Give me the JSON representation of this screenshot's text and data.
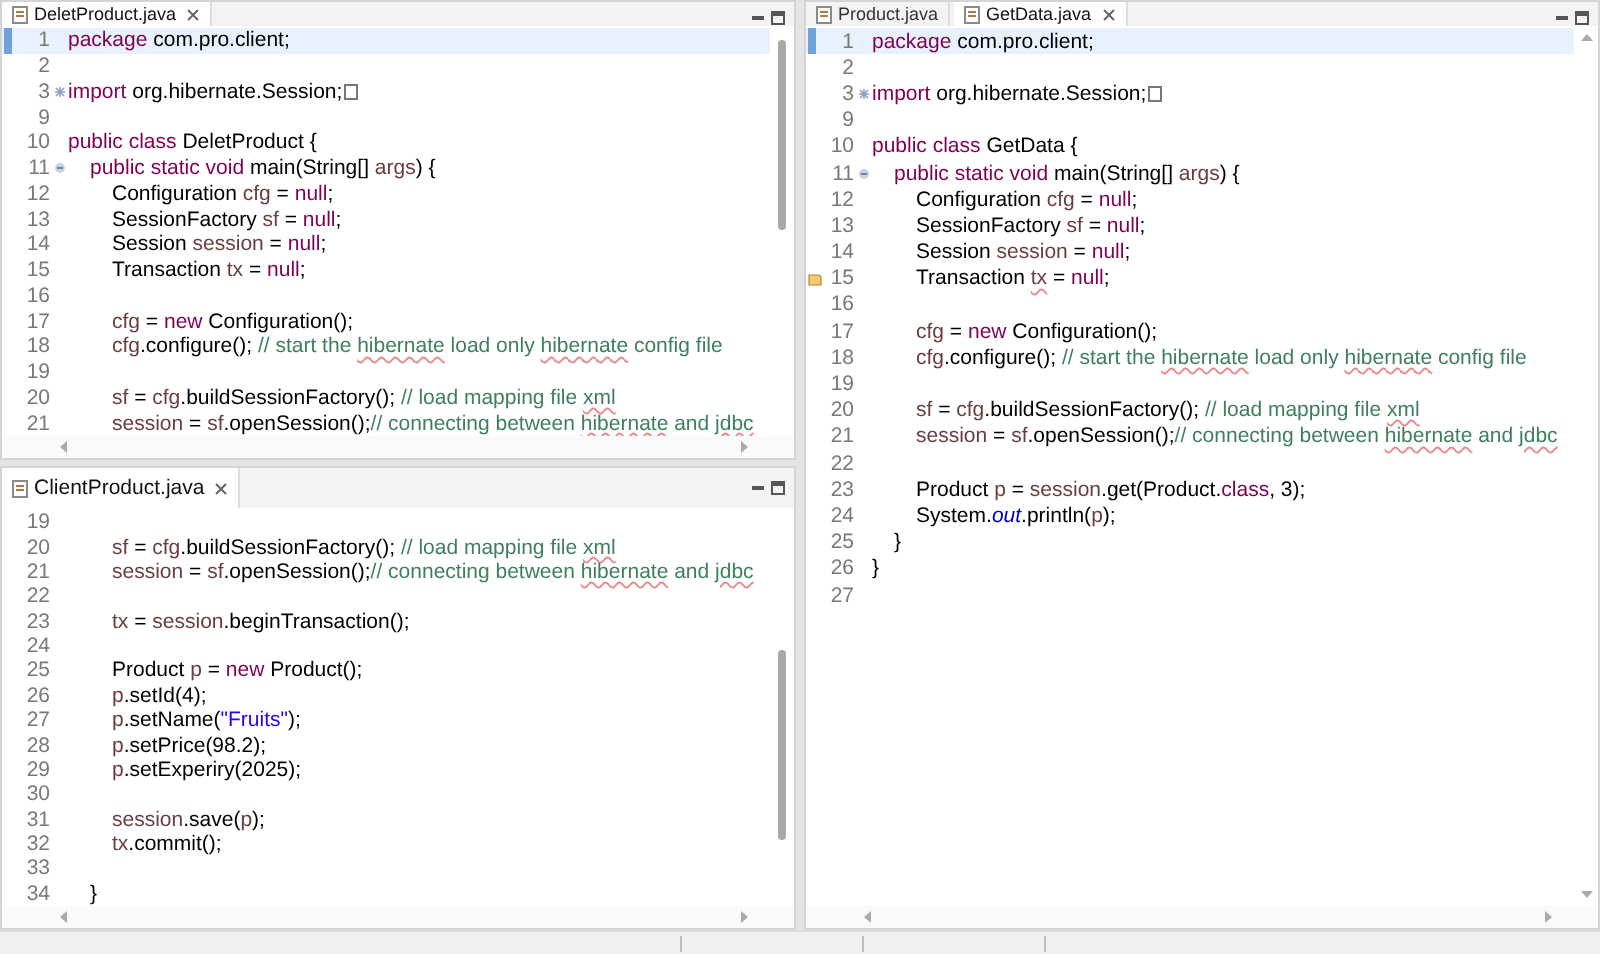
{
  "editors": [
    {
      "tabs": [
        {
          "label": "DeletProduct.java",
          "selected": true
        }
      ],
      "lines": [
        {
          "num": "1",
          "highlighted": true,
          "segs": [
            {
              "kind": "kw",
              "text": "package"
            },
            {
              "kind": "plain",
              "text": " com.pro.client;"
            }
          ]
        },
        {
          "num": "2"
        },
        {
          "num": "3",
          "collapsed": true,
          "segs": [
            {
              "kind": "kw",
              "text": "import"
            },
            {
              "kind": "plain",
              "text": " org.hibernate.Session;"
            }
          ]
        },
        {
          "num": "9"
        },
        {
          "num": "10",
          "segs": [
            {
              "kind": "kw",
              "text": "public class"
            },
            {
              "kind": "plain",
              "text": " DeletProduct {"
            }
          ]
        },
        {
          "num": "11",
          "collapsed": false,
          "segs": [
            {
              "kind": "kw",
              "text": "\tpublic static void"
            },
            {
              "kind": "plain",
              "text": " main(String[] "
            },
            {
              "kind": "var",
              "text": "args"
            },
            {
              "kind": "plain",
              "text": ") {"
            }
          ]
        },
        {
          "num": "12",
          "segs": [
            {
              "kind": "plain",
              "text": "\t\tConfiguration "
            },
            {
              "kind": "var",
              "text": "cfg"
            },
            {
              "kind": "plain",
              "text": " = "
            },
            {
              "kind": "kw",
              "text": "null"
            },
            {
              "kind": "plain",
              "text": ";"
            }
          ]
        },
        {
          "num": "13",
          "segs": [
            {
              "kind": "plain",
              "text": "\t\tSessionFactory "
            },
            {
              "kind": "var",
              "text": "sf"
            },
            {
              "kind": "plain",
              "text": " = "
            },
            {
              "kind": "kw",
              "text": "null"
            },
            {
              "kind": "plain",
              "text": ";"
            }
          ]
        },
        {
          "num": "14",
          "segs": [
            {
              "kind": "plain",
              "text": "\t\tSession "
            },
            {
              "kind": "var",
              "text": "session"
            },
            {
              "kind": "plain",
              "text": " = "
            },
            {
              "kind": "kw",
              "text": "null"
            },
            {
              "kind": "plain",
              "text": ";"
            }
          ]
        },
        {
          "num": "15",
          "segs": [
            {
              "kind": "plain",
              "text": "\t\tTransaction "
            },
            {
              "kind": "var",
              "text": "tx"
            },
            {
              "kind": "plain",
              "text": " = "
            },
            {
              "kind": "kw",
              "text": "null"
            },
            {
              "kind": "plain",
              "text": ";"
            }
          ]
        },
        {
          "num": "16"
        },
        {
          "num": "17",
          "segs": [
            {
              "kind": "var",
              "text": "\t\tcfg"
            },
            {
              "kind": "plain",
              "text": " = "
            },
            {
              "kind": "kw",
              "text": "new"
            },
            {
              "kind": "plain",
              "text": " Configuration();"
            }
          ]
        },
        {
          "num": "18",
          "segs": [
            {
              "kind": "var",
              "text": "\t\tcfg"
            },
            {
              "kind": "plain",
              "text": ".configure(); "
            },
            {
              "kind": "comment",
              "text": "// start the "
            },
            {
              "kind": "comment",
              "text": "hibernate",
              "underlined": true
            },
            {
              "kind": "comment",
              "text": " load only "
            },
            {
              "kind": "comment",
              "text": "hibernate",
              "underlined": true
            },
            {
              "kind": "comment",
              "text": " config file"
            }
          ]
        },
        {
          "num": "19"
        },
        {
          "num": "20",
          "segs": [
            {
              "kind": "var",
              "text": "\t\tsf"
            },
            {
              "kind": "plain",
              "text": " = "
            },
            {
              "kind": "var",
              "text": "cfg"
            },
            {
              "kind": "plain",
              "text": ".buildSessionFactory(); "
            },
            {
              "kind": "comment",
              "text": "// load mapping file "
            },
            {
              "kind": "comment",
              "text": "xml",
              "underlined": true
            }
          ]
        },
        {
          "num": "21",
          "segs": [
            {
              "kind": "var",
              "text": "\t\tsession"
            },
            {
              "kind": "plain",
              "text": " = "
            },
            {
              "kind": "var",
              "text": "sf"
            },
            {
              "kind": "plain",
              "text": ".openSession();"
            },
            {
              "kind": "comment",
              "text": "// connecting between "
            },
            {
              "kind": "comment",
              "text": "hibernate",
              "underlined": true
            },
            {
              "kind": "comment",
              "text": " and "
            },
            {
              "kind": "comment",
              "text": "jdbc",
              "underlined": true
            }
          ]
        }
      ]
    },
    {
      "tabs": [
        {
          "label": "ClientProduct.java",
          "selected": true
        }
      ],
      "lines": [
        {
          "num": "19"
        },
        {
          "num": "20",
          "segs": [
            {
              "kind": "var",
              "text": "\t\tsf"
            },
            {
              "kind": "plain",
              "text": " = "
            },
            {
              "kind": "var",
              "text": "cfg"
            },
            {
              "kind": "plain",
              "text": ".buildSessionFactory(); "
            },
            {
              "kind": "comment",
              "text": "// load mapping file "
            },
            {
              "kind": "comment",
              "text": "xml",
              "underlined": true
            }
          ]
        },
        {
          "num": "21",
          "segs": [
            {
              "kind": "var",
              "text": "\t\tsession"
            },
            {
              "kind": "plain",
              "text": " = "
            },
            {
              "kind": "var",
              "text": "sf"
            },
            {
              "kind": "plain",
              "text": ".openSession();"
            },
            {
              "kind": "comment",
              "text": "// connecting between "
            },
            {
              "kind": "comment",
              "text": "hibernate",
              "underlined": true
            },
            {
              "kind": "comment",
              "text": " and "
            },
            {
              "kind": "comment",
              "text": "jdbc",
              "underlined": true
            }
          ]
        },
        {
          "num": "22"
        },
        {
          "num": "23",
          "segs": [
            {
              "kind": "var",
              "text": "\t\ttx"
            },
            {
              "kind": "plain",
              "text": " = "
            },
            {
              "kind": "var",
              "text": "session"
            },
            {
              "kind": "plain",
              "text": ".beginTransaction();"
            }
          ]
        },
        {
          "num": "24"
        },
        {
          "num": "25",
          "segs": [
            {
              "kind": "plain",
              "text": "\t\tProduct "
            },
            {
              "kind": "var",
              "text": "p"
            },
            {
              "kind": "plain",
              "text": " = "
            },
            {
              "kind": "kw",
              "text": "new"
            },
            {
              "kind": "plain",
              "text": " Product();"
            }
          ]
        },
        {
          "num": "26",
          "segs": [
            {
              "kind": "var",
              "text": "\t\tp"
            },
            {
              "kind": "plain",
              "text": ".setId(4);"
            }
          ]
        },
        {
          "num": "27",
          "segs": [
            {
              "kind": "var",
              "text": "\t\tp"
            },
            {
              "kind": "plain",
              "text": ".setName("
            },
            {
              "kind": "string",
              "text": "\"Fruits\""
            },
            {
              "kind": "plain",
              "text": ");"
            }
          ]
        },
        {
          "num": "28",
          "segs": [
            {
              "kind": "var",
              "text": "\t\tp"
            },
            {
              "kind": "plain",
              "text": ".setPrice(98.2);"
            }
          ]
        },
        {
          "num": "29",
          "segs": [
            {
              "kind": "var",
              "text": "\t\tp"
            },
            {
              "kind": "plain",
              "text": ".setExperiry(2025);"
            }
          ]
        },
        {
          "num": "30"
        },
        {
          "num": "31",
          "segs": [
            {
              "kind": "var",
              "text": "\t\tsession"
            },
            {
              "kind": "plain",
              "text": ".save("
            },
            {
              "kind": "var",
              "text": "p"
            },
            {
              "kind": "plain",
              "text": ");"
            }
          ]
        },
        {
          "num": "32",
          "segs": [
            {
              "kind": "var",
              "text": "\t\ttx"
            },
            {
              "kind": "plain",
              "text": ".commit();"
            }
          ]
        },
        {
          "num": "33"
        },
        {
          "num": "34",
          "segs": [
            {
              "kind": "plain",
              "text": "\t}"
            }
          ]
        }
      ]
    },
    {
      "tabs": [
        {
          "label": "Product.java",
          "selected": false
        },
        {
          "label": "GetData.java",
          "selected": true
        }
      ],
      "lines": [
        {
          "num": "1",
          "highlighted": true,
          "segs": [
            {
              "kind": "kw",
              "text": "package"
            },
            {
              "kind": "plain",
              "text": " com.pro.client;"
            }
          ]
        },
        {
          "num": "2"
        },
        {
          "num": "3",
          "collapsed": true,
          "segs": [
            {
              "kind": "kw",
              "text": "import"
            },
            {
              "kind": "plain",
              "text": " org.hibernate.Session;"
            }
          ]
        },
        {
          "num": "9"
        },
        {
          "num": "10",
          "segs": [
            {
              "kind": "kw",
              "text": "public class"
            },
            {
              "kind": "plain",
              "text": " GetData {"
            }
          ]
        },
        {
          "num": "11",
          "collapsed": false,
          "segs": [
            {
              "kind": "kw",
              "text": "\tpublic static void"
            },
            {
              "kind": "plain",
              "text": " main(String[] "
            },
            {
              "kind": "var",
              "text": "args"
            },
            {
              "kind": "plain",
              "text": ") {"
            }
          ]
        },
        {
          "num": "12",
          "segs": [
            {
              "kind": "plain",
              "text": "\t\tConfiguration "
            },
            {
              "kind": "var",
              "text": "cfg"
            },
            {
              "kind": "plain",
              "text": " = "
            },
            {
              "kind": "kw",
              "text": "null"
            },
            {
              "kind": "plain",
              "text": ";"
            }
          ]
        },
        {
          "num": "13",
          "segs": [
            {
              "kind": "plain",
              "text": "\t\tSessionFactory "
            },
            {
              "kind": "var",
              "text": "sf"
            },
            {
              "kind": "plain",
              "text": " = "
            },
            {
              "kind": "kw",
              "text": "null"
            },
            {
              "kind": "plain",
              "text": ";"
            }
          ]
        },
        {
          "num": "14",
          "segs": [
            {
              "kind": "plain",
              "text": "\t\tSession "
            },
            {
              "kind": "var",
              "text": "session"
            },
            {
              "kind": "plain",
              "text": " = "
            },
            {
              "kind": "kw",
              "text": "null"
            },
            {
              "kind": "plain",
              "text": ";"
            }
          ]
        },
        {
          "num": "15",
          "warning": true,
          "segs": [
            {
              "kind": "plain",
              "text": "\t\tTransaction "
            },
            {
              "kind": "var",
              "text": "tx",
              "underlined": true
            },
            {
              "kind": "plain",
              "text": " = "
            },
            {
              "kind": "kw",
              "text": "null"
            },
            {
              "kind": "plain",
              "text": ";"
            }
          ]
        },
        {
          "num": "16"
        },
        {
          "num": "17",
          "segs": [
            {
              "kind": "var",
              "text": "\t\tcfg"
            },
            {
              "kind": "plain",
              "text": " = "
            },
            {
              "kind": "kw",
              "text": "new"
            },
            {
              "kind": "plain",
              "text": " Configuration();"
            }
          ]
        },
        {
          "num": "18",
          "segs": [
            {
              "kind": "var",
              "text": "\t\tcfg"
            },
            {
              "kind": "plain",
              "text": ".configure(); "
            },
            {
              "kind": "comment",
              "text": "// start the "
            },
            {
              "kind": "comment",
              "text": "hibernate",
              "underlined": true
            },
            {
              "kind": "comment",
              "text": " load only "
            },
            {
              "kind": "comment",
              "text": "hibernate",
              "underlined": true
            },
            {
              "kind": "comment",
              "text": " config file"
            }
          ]
        },
        {
          "num": "19"
        },
        {
          "num": "20",
          "segs": [
            {
              "kind": "var",
              "text": "\t\tsf"
            },
            {
              "kind": "plain",
              "text": " = "
            },
            {
              "kind": "var",
              "text": "cfg"
            },
            {
              "kind": "plain",
              "text": ".buildSessionFactory(); "
            },
            {
              "kind": "comment",
              "text": "// load mapping file "
            },
            {
              "kind": "comment",
              "text": "xml",
              "underlined": true
            }
          ]
        },
        {
          "num": "21",
          "segs": [
            {
              "kind": "var",
              "text": "\t\tsession"
            },
            {
              "kind": "plain",
              "text": " = "
            },
            {
              "kind": "var",
              "text": "sf"
            },
            {
              "kind": "plain",
              "text": ".openSession();"
            },
            {
              "kind": "comment",
              "text": "// connecting between "
            },
            {
              "kind": "comment",
              "text": "hibernate",
              "underlined": true
            },
            {
              "kind": "comment",
              "text": " and "
            },
            {
              "kind": "comment",
              "text": "jdbc",
              "underlined": true
            }
          ]
        },
        {
          "num": "22"
        },
        {
          "num": "23",
          "segs": [
            {
              "kind": "plain",
              "text": "\t\tProduct "
            },
            {
              "kind": "var",
              "text": "p"
            },
            {
              "kind": "plain",
              "text": " = "
            },
            {
              "kind": "var",
              "text": "session"
            },
            {
              "kind": "plain",
              "text": ".get(Product."
            },
            {
              "kind": "kw",
              "text": "class"
            },
            {
              "kind": "plain",
              "text": ", 3);"
            }
          ]
        },
        {
          "num": "24",
          "segs": [
            {
              "kind": "plain",
              "text": "\t\tSystem."
            },
            {
              "kind": "static",
              "text": "out"
            },
            {
              "kind": "plain",
              "text": ".println("
            },
            {
              "kind": "var",
              "text": "p"
            },
            {
              "kind": "plain",
              "text": ");"
            }
          ]
        },
        {
          "num": "25",
          "segs": [
            {
              "kind": "plain",
              "text": "\t}"
            }
          ]
        },
        {
          "num": "26",
          "segs": [
            {
              "kind": "plain",
              "text": "}"
            }
          ]
        },
        {
          "num": "27"
        }
      ]
    }
  ]
}
